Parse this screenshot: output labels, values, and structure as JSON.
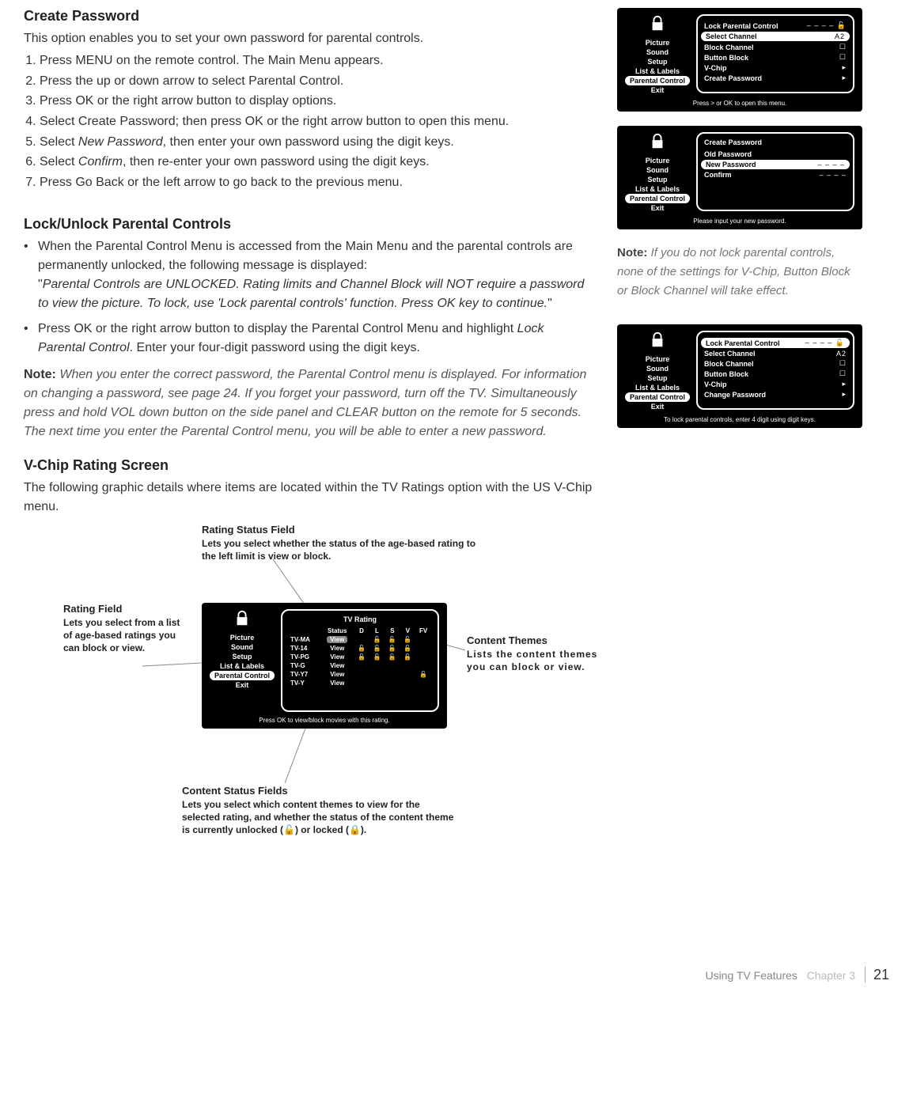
{
  "sections": {
    "create_password": {
      "title": "Create Password",
      "intro": "This option enables you to set your own password for parental controls.",
      "steps": [
        "Press MENU on the remote control. The Main Menu appears.",
        "Press the up or down arrow to select Parental Control.",
        "Press OK or the right arrow button to display options.",
        "Select Create Password; then press OK or the right arrow button to open this menu.",
        "Select New Password, then enter your own password using the digit keys.",
        "Select Confirm, then re-enter your own password using the digit keys.",
        "Press Go Back or the left arrow to go back to the previous menu."
      ]
    },
    "lock_unlock": {
      "title": "Lock/Unlock Parental Controls",
      "bullets": [
        "When the Parental Control Menu is accessed from the Main Menu and the parental controls are permanently unlocked, the following message is displayed: \"Parental Controls are UNLOCKED. Rating limits and Channel Block will NOT require a password to view the picture. To lock, use 'Lock parental controls' function. Press OK key to continue.\"",
        "Press OK or the right arrow button to display the Parental Control Menu and highlight Lock Parental Control. Enter your four-digit password using the digit keys."
      ],
      "note": "When you enter the correct password, the Parental Control menu is displayed. For information on changing a password, see page 24. If you forget your password, turn off the TV. Simultaneously press and hold VOL down button on the side panel and CLEAR button on the remote for 5 seconds. The next time you enter the Parental Control menu, you will be able to enter a new password."
    },
    "vchip_screen": {
      "title": "V-Chip Rating Screen",
      "intro": "The following graphic details where items are located within the TV Ratings option with the US V-Chip menu."
    }
  },
  "tv_menus": {
    "sidebar": [
      "Picture",
      "Sound",
      "Setup",
      "List & Labels",
      "Parental Control",
      "Exit"
    ],
    "menu1": {
      "rows": [
        {
          "label": "Lock Parental Control",
          "val": "– – – –  🔓"
        },
        {
          "label": "Select Channel",
          "val": "A2",
          "sel": true
        },
        {
          "label": "Block Channel",
          "val": "☐"
        },
        {
          "label": "Button Block",
          "val": "☐"
        },
        {
          "label": "V-Chip",
          "val": "▸"
        },
        {
          "label": "Create Password",
          "val": "▸"
        }
      ],
      "footer": "Press > or OK to open this menu."
    },
    "menu2": {
      "title": "Create Password",
      "rows": [
        {
          "label": "Old Password",
          "val": ""
        },
        {
          "label": "New Password",
          "val": "– – – –",
          "sel": true
        },
        {
          "label": "Confirm",
          "val": "– – – –"
        }
      ],
      "footer": "Please input your new password."
    },
    "menu3": {
      "rows": [
        {
          "label": "Lock Parental Control",
          "val": "– – – –  🔓",
          "sel": true
        },
        {
          "label": "Select Channel",
          "val": "A2"
        },
        {
          "label": "Block Channel",
          "val": "☐"
        },
        {
          "label": "Button Block",
          "val": "☐"
        },
        {
          "label": "V-Chip",
          "val": "▸"
        },
        {
          "label": "Change Password",
          "val": "▸"
        }
      ],
      "footer": "To lock parental controls, enter 4 digit using digit keys."
    },
    "ratings": {
      "title": "TV Rating",
      "headers": [
        "",
        "Status",
        "D",
        "L",
        "S",
        "V",
        "FV"
      ],
      "rows": [
        {
          "r": "TV-MA",
          "s": "View",
          "c": [
            "",
            "🔓",
            "🔓",
            "🔓",
            ""
          ]
        },
        {
          "r": "TV-14",
          "s": "View",
          "c": [
            "🔓",
            "🔓",
            "🔓",
            "🔓",
            ""
          ]
        },
        {
          "r": "TV-PG",
          "s": "View",
          "c": [
            "🔓",
            "🔓",
            "🔓",
            "🔓",
            ""
          ]
        },
        {
          "r": "TV-G",
          "s": "View",
          "c": [
            "",
            "",
            "",
            "",
            ""
          ]
        },
        {
          "r": "TV-Y7",
          "s": "View",
          "c": [
            "",
            "",
            "",
            "",
            "🔓"
          ]
        },
        {
          "r": "TV-Y",
          "s": "View",
          "c": [
            "",
            "",
            "",
            "",
            ""
          ]
        }
      ],
      "footer": "Press OK  to view/block movies with this rating."
    }
  },
  "side_note": {
    "label": "Note:",
    "text": "If you do not lock parental controls, none of the settings for V-Chip, Button Block or Block Channel will take effect."
  },
  "callouts": {
    "rating_status": {
      "title": "Rating Status Field",
      "desc": "Lets you select whether the status of the age-based rating to the left limit is view or block."
    },
    "rating_field": {
      "title": "Rating Field",
      "desc": "Lets you select from a list of age-based ratings you can block or view."
    },
    "content_themes": {
      "title": "Content Themes",
      "desc": "Lists the content themes you can block or view."
    },
    "content_status": {
      "title": "Content Status Fields",
      "desc": "Lets you select which content themes to view for the selected rating, and whether the status of the content theme is currently unlocked (🔓) or locked (🔒)."
    }
  },
  "footer": {
    "section": "Using TV Features",
    "chapter": "Chapter 3",
    "page": "21"
  }
}
